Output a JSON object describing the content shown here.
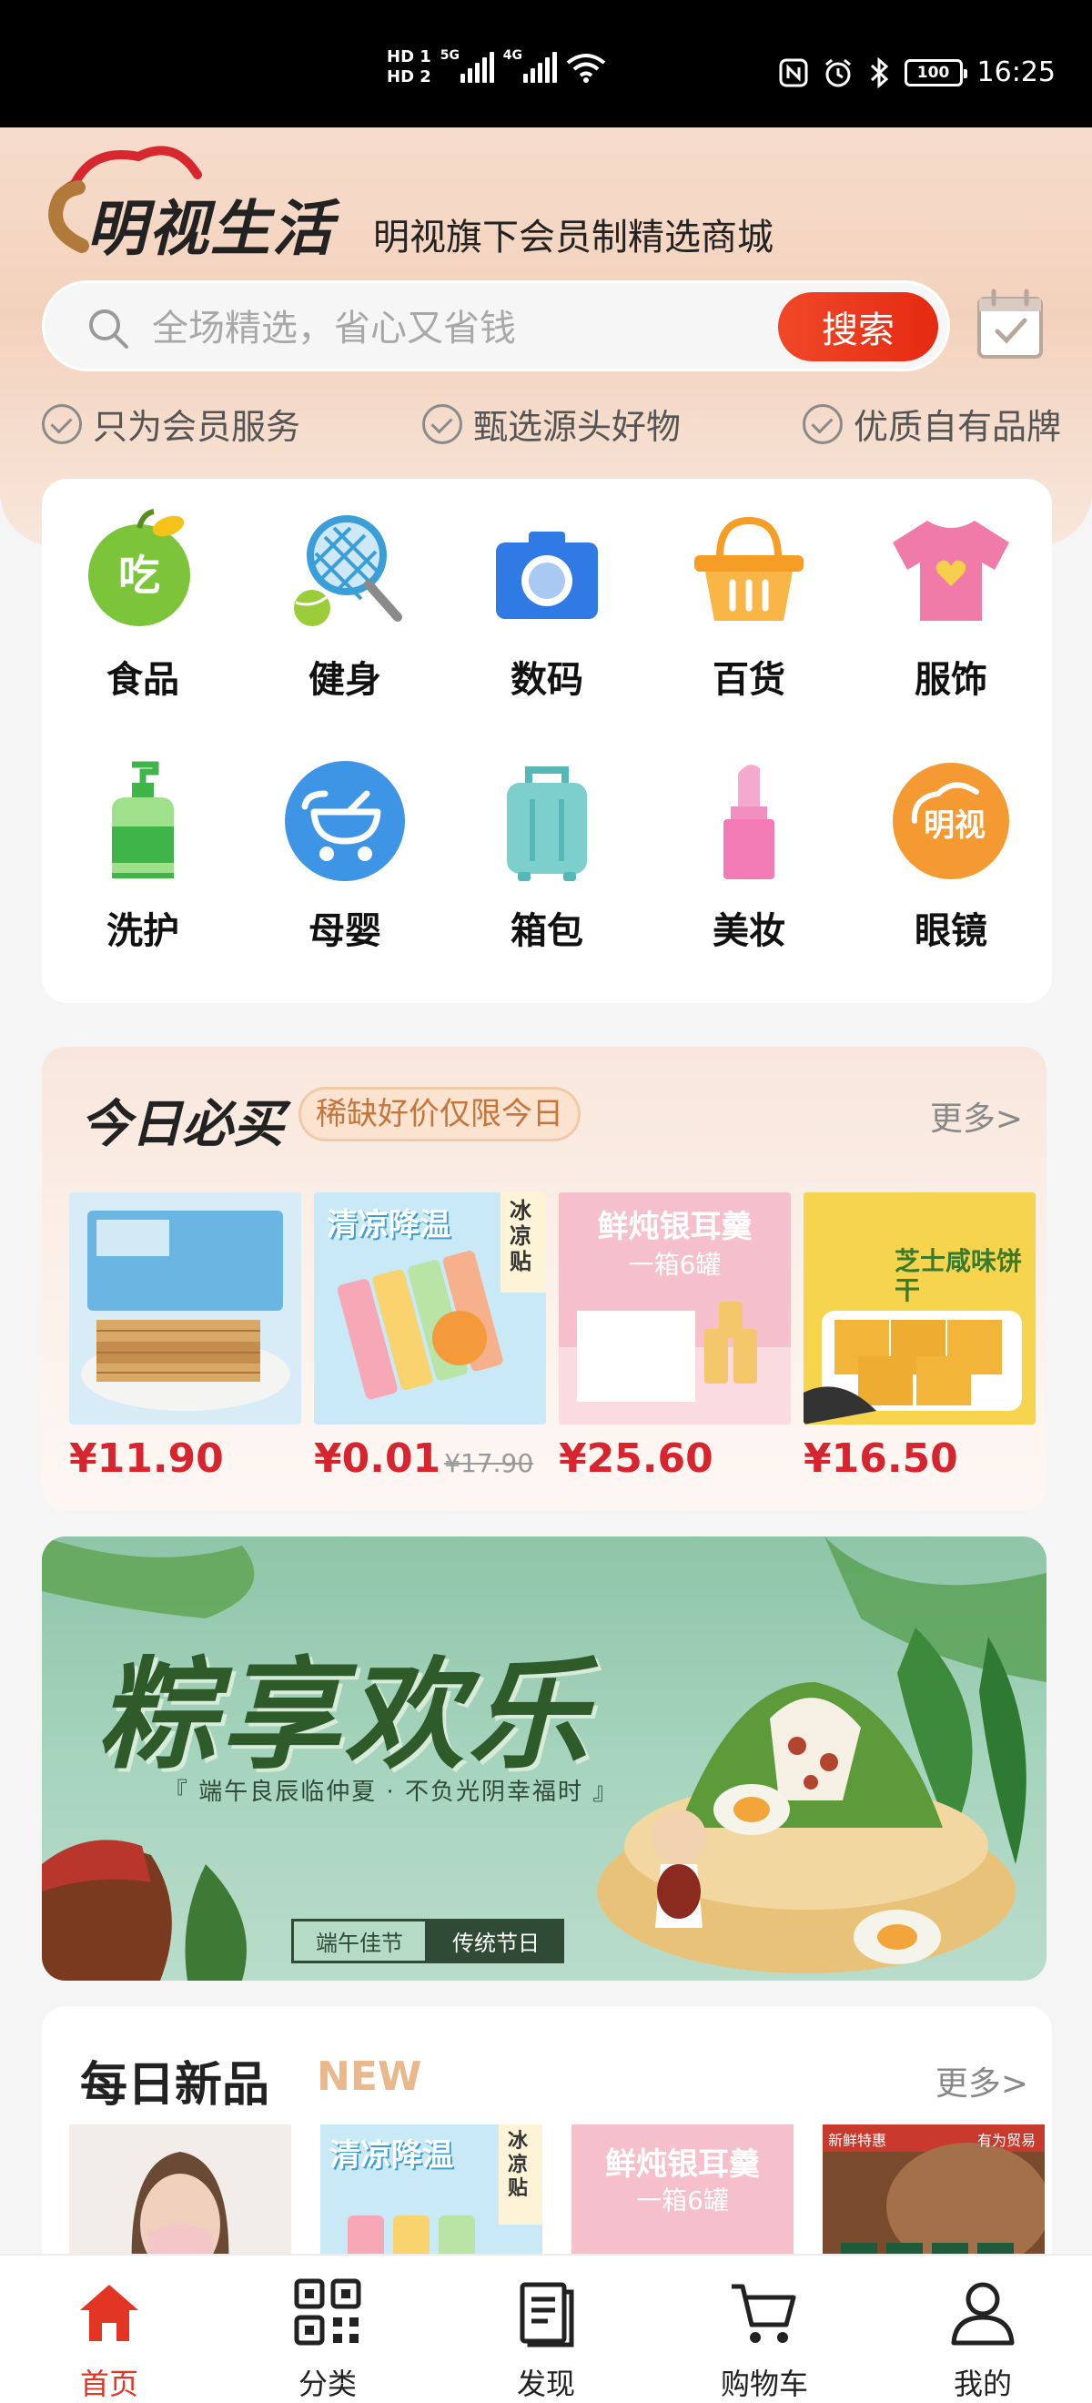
{
  "status_bar": {
    "hd1": "HD 1",
    "hd2": "HD 2",
    "net1": "5G",
    "net2": "4G",
    "battery": "100",
    "time": "16:25"
  },
  "header": {
    "logo_text": "明视生活",
    "tagline": "明视旗下会员制精选商城",
    "search_placeholder": "全场精选，省心又省钱",
    "search_button": "搜索",
    "promises": [
      "只为会员服务",
      "甄选源头好物",
      "优质自有品牌"
    ]
  },
  "categories": [
    {
      "label": "食品",
      "icon": "apple-icon",
      "icon_text": "吃"
    },
    {
      "label": "健身",
      "icon": "tennis-racket-icon"
    },
    {
      "label": "数码",
      "icon": "camera-icon"
    },
    {
      "label": "百货",
      "icon": "basket-icon"
    },
    {
      "label": "服饰",
      "icon": "tshirt-icon"
    },
    {
      "label": "洗护",
      "icon": "pump-bottle-icon"
    },
    {
      "label": "母婴",
      "icon": "stroller-icon"
    },
    {
      "label": "箱包",
      "icon": "suitcase-icon"
    },
    {
      "label": "美妆",
      "icon": "lipstick-icon"
    },
    {
      "label": "眼镜",
      "icon": "mingshi-logo-icon",
      "icon_text": "明视"
    }
  ],
  "today": {
    "title": "今日必买",
    "badge": "稀缺好价仅限今日",
    "more": "更多>",
    "products": [
      {
        "price": "¥11.90",
        "old_price": "",
        "img_text": "",
        "img": "wafer-biscuit"
      },
      {
        "price": "¥0.01",
        "old_price": "¥17.90",
        "img_text": "清凉降温",
        "img_side": "冰凉贴",
        "img": "cooling-patch"
      },
      {
        "price": "¥25.60",
        "old_price": "",
        "img_text": "鲜炖银耳羹",
        "img_sub": "一箱6罐",
        "img": "tremella-soup"
      },
      {
        "price": "¥16.50",
        "old_price": "",
        "img_text": "芝士咸味饼干",
        "img": "cheese-cracker"
      }
    ]
  },
  "banner": {
    "title": "粽享欢乐",
    "subtitle": "『 端午良辰临仲夏 · 不负光阴幸福时 』",
    "tag1": "端午佳节",
    "tag2": "传统节日"
  },
  "daily": {
    "title": "每日新品",
    "new_label": "NEW",
    "more": "更多>",
    "products": [
      {
        "img": "face-mask-woman",
        "img_text": ""
      },
      {
        "img": "cooling-patch",
        "img_text": "清凉降温",
        "img_side": "冰凉贴"
      },
      {
        "img": "tremella-soup",
        "img_text": "鲜炖银耳羹",
        "img_sub": "一箱6罐"
      },
      {
        "img": "coffee-cans",
        "img_text": "新鲜特惠",
        "img_side": "有为贸易"
      }
    ]
  },
  "tabbar": {
    "tabs": [
      {
        "label": "首页",
        "icon": "home-icon",
        "active": true
      },
      {
        "label": "分类",
        "icon": "qr-grid-icon",
        "active": false
      },
      {
        "label": "发现",
        "icon": "document-icon",
        "active": false
      },
      {
        "label": "购物车",
        "icon": "cart-icon",
        "active": false
      },
      {
        "label": "我的",
        "icon": "user-icon",
        "active": false
      }
    ]
  },
  "colors": {
    "accent_red": "#e33523",
    "price_red": "#d6252e",
    "header_bg": "#f3d2bd"
  }
}
